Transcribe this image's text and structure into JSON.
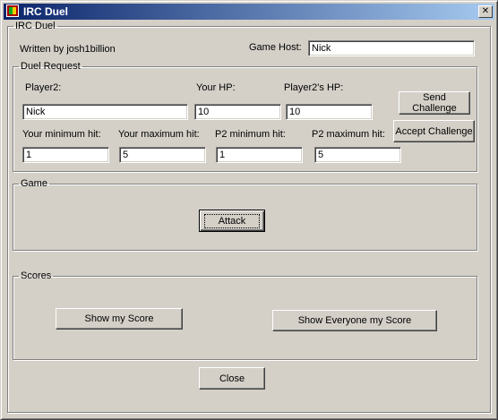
{
  "window": {
    "title": "IRC Duel",
    "close_glyph": "✕"
  },
  "main_group": {
    "legend": "IRC Duel",
    "written_by": "Written by josh1billion",
    "game_host_label": "Game Host:",
    "game_host_value": "Nick"
  },
  "duel_request": {
    "legend": "Duel Request",
    "player2_label": "Player2:",
    "player2_value": "Nick",
    "your_hp_label": "Your HP:",
    "your_hp_value": "10",
    "p2_hp_label": "Player2's HP:",
    "p2_hp_value": "10",
    "your_min_label": "Your minimum hit:",
    "your_min_value": "1",
    "your_max_label": "Your maximum hit:",
    "your_max_value": "5",
    "p2_min_label": "P2 minimum hit:",
    "p2_min_value": "1",
    "p2_max_label": "P2 maximum hit:",
    "p2_max_value": "5",
    "send_challenge": "Send Challenge",
    "accept_challenge": "Accept Challenge"
  },
  "game": {
    "legend": "Game",
    "attack": "Attack"
  },
  "scores": {
    "legend": "Scores",
    "show_my_score": "Show my Score",
    "show_everyone": "Show Everyone my Score"
  },
  "close_button": "Close",
  "icons": {
    "app": "irc-duel-app-icon",
    "close": "close-icon"
  }
}
